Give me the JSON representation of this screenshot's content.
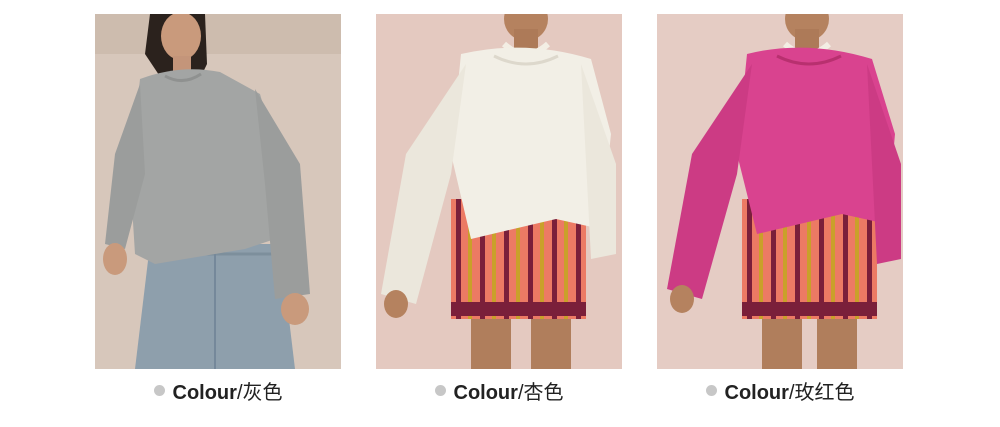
{
  "products": [
    {
      "label": "Colour",
      "separator": "/",
      "colour_name": "灰色",
      "sweater_color": "#a3a5a4",
      "background_color": "#d7c7bb",
      "bottom": "denim-skirt"
    },
    {
      "label": "Colour",
      "separator": "/",
      "colour_name": "杏色",
      "sweater_color": "#f2efe6",
      "background_color": "#e4c9c0",
      "bottom": "striped-shorts"
    },
    {
      "label": "Colour",
      "separator": "/",
      "colour_name": "玫红色",
      "sweater_color": "#d9438f",
      "background_color": "#e5ccc4",
      "bottom": "striped-shorts"
    }
  ],
  "bullet_color": "#c7c7c7"
}
